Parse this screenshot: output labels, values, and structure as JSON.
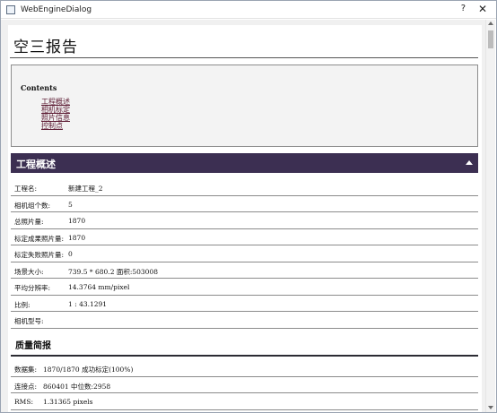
{
  "window": {
    "title": "WebEngineDialog",
    "help": "?",
    "close": "✕"
  },
  "report": {
    "title": "空三报告",
    "contents": {
      "heading": "Contents",
      "links": [
        "工程概述",
        "相机标定",
        "照片信息",
        "控制点"
      ]
    },
    "overview": {
      "title": "工程概述",
      "rows": [
        {
          "label": "工程名:",
          "value": "新建工程_2"
        },
        {
          "label": "相机组个数:",
          "value": "5"
        },
        {
          "label": "总照片量:",
          "value": "1870"
        },
        {
          "label": "标定成果照片量:",
          "value": "1870"
        },
        {
          "label": "标定失败照片量:",
          "value": "0"
        },
        {
          "label": "场景大小:",
          "value": "739.5 * 680.2 面积:503008"
        },
        {
          "label": "平均分辨率:",
          "value": "14.3764 mm/pixel"
        },
        {
          "label": "比例:",
          "value": "1 : 43.1291"
        },
        {
          "label": "相机型号:",
          "value": ""
        }
      ]
    },
    "quality": {
      "title": "质量简报",
      "rows": [
        {
          "label": "数据集:",
          "value": "1870/1870 成功标定(100%)"
        },
        {
          "label": "连接点:",
          "value": "860401 中位数:2958"
        },
        {
          "label": "RMS:",
          "value": "1.31365 pixels"
        }
      ]
    }
  },
  "colors": {
    "section_bar": "#3c2f52",
    "link": "#5a1830"
  }
}
